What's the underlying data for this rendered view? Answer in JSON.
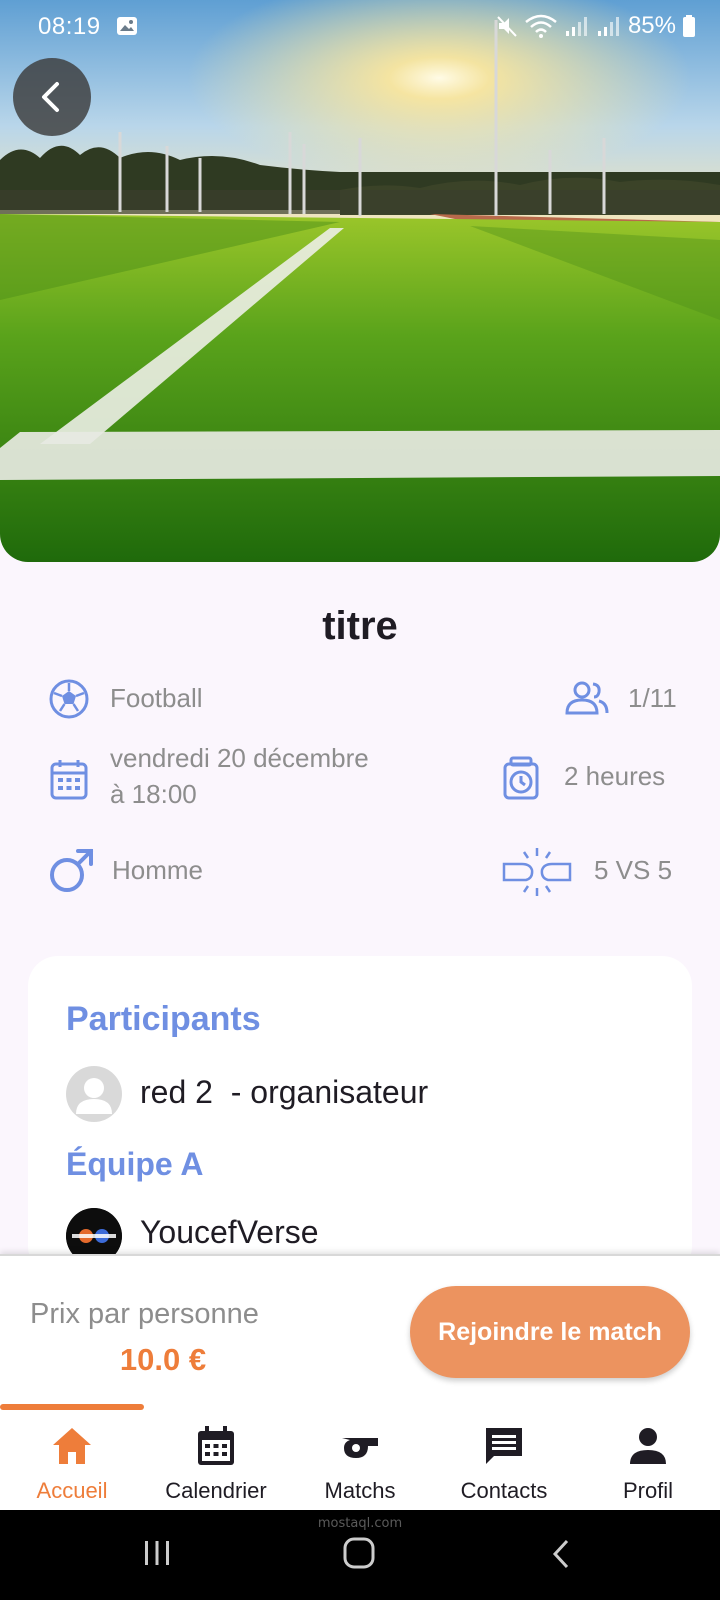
{
  "status": {
    "time": "08:19",
    "battery": "85%"
  },
  "event": {
    "title": "titre",
    "sport": "Football",
    "players": "1/11",
    "date_line1": "vendredi 20 décembre",
    "date_line2": "à 18:00",
    "duration": "2 heures",
    "gender": "Homme",
    "format": "5 VS 5"
  },
  "participants": {
    "title": "Participants",
    "organizer": "red 2  - organisateur",
    "team_a_title": "Équipe A",
    "team_a_member": "YoucefVerse"
  },
  "footer": {
    "price_label": "Prix par personne",
    "price_value": "10.0 €",
    "join_label": "Rejoindre le match"
  },
  "nav": {
    "items": [
      {
        "label": "Accueil",
        "icon": "home-icon"
      },
      {
        "label": "Calendrier",
        "icon": "calendar-icon"
      },
      {
        "label": "Matchs",
        "icon": "whistle-icon"
      },
      {
        "label": "Contacts",
        "icon": "chat-icon"
      },
      {
        "label": "Profil",
        "icon": "person-icon"
      }
    ]
  },
  "watermark": "mostaql.com",
  "colors": {
    "accent": "#ee7d3a",
    "blue": "#6f8fe2",
    "background": "#fbf6fd"
  }
}
